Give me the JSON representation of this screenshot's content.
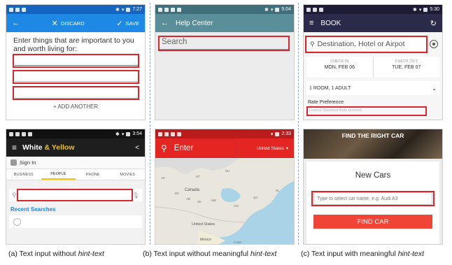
{
  "s1": {
    "time": "7:27",
    "discard_label": "DISCARD",
    "save_label": "SAVE",
    "prompt": "Enter things that are important to you and worth living for:",
    "add_another": "+ ADD ANOTHER",
    "accent": "#1e88e5"
  },
  "s2": {
    "time": "5:04",
    "title": "Help Center",
    "search_text": "Search",
    "accent": "#5a8f9a"
  },
  "s3": {
    "time": "5:30",
    "title": "BOOK",
    "destination_text": "Destination, Hotel or Airpot",
    "checkin_label": "CHECK IN",
    "checkin_value": "MON, FEB 06",
    "checkout_label": "CHECK OUT",
    "checkout_value": "TUE, FEB 07",
    "rooms": "1 ROOM, 1 ADULT",
    "rate_label": "Rate Preference",
    "rate_placeholder": "Lowest Standard Rate (locked)",
    "accent": "#2c2a4a"
  },
  "s4": {
    "time": "3:54",
    "title_white": "White",
    "title_amp_yellow": " & Yellow",
    "sign_in": "Sign In",
    "tabs": [
      "BUSINESS",
      "PEOPLE",
      "PHONE",
      "MOVIES"
    ],
    "recent": "Recent Searches",
    "accent": "#1e1e1e",
    "yellow": "#f4c20d"
  },
  "s5": {
    "time": "2:33",
    "enter_text": "Enter",
    "country": "United States",
    "accent": "#e52521",
    "map_labels": {
      "canada": "Canada",
      "united_states": "United States",
      "mexico": "Mexico",
      "nu": "NU",
      "nt": "NT",
      "qc": "QC",
      "on": "ON",
      "bc": "BC",
      "ab": "AB",
      "sk": "SK",
      "mb": "MB",
      "nl": "NL",
      "ak": "AK",
      "cuba": "Cuba"
    }
  },
  "s6": {
    "banner": "FIND THE RIGHT CAR",
    "heading": "New Cars",
    "input_placeholder": "Type to select car name, e.g. Audi A3",
    "button": "FIND CAR",
    "accent": "#f04437"
  },
  "captions": {
    "a_prefix": "(a) Text input without ",
    "a_italic": "hint-text",
    "b_prefix": "(b) Text input without meaningful ",
    "b_italic": "hint-text",
    "c_prefix": "(c) Text input with meaningful ",
    "c_italic": "hint-text"
  }
}
